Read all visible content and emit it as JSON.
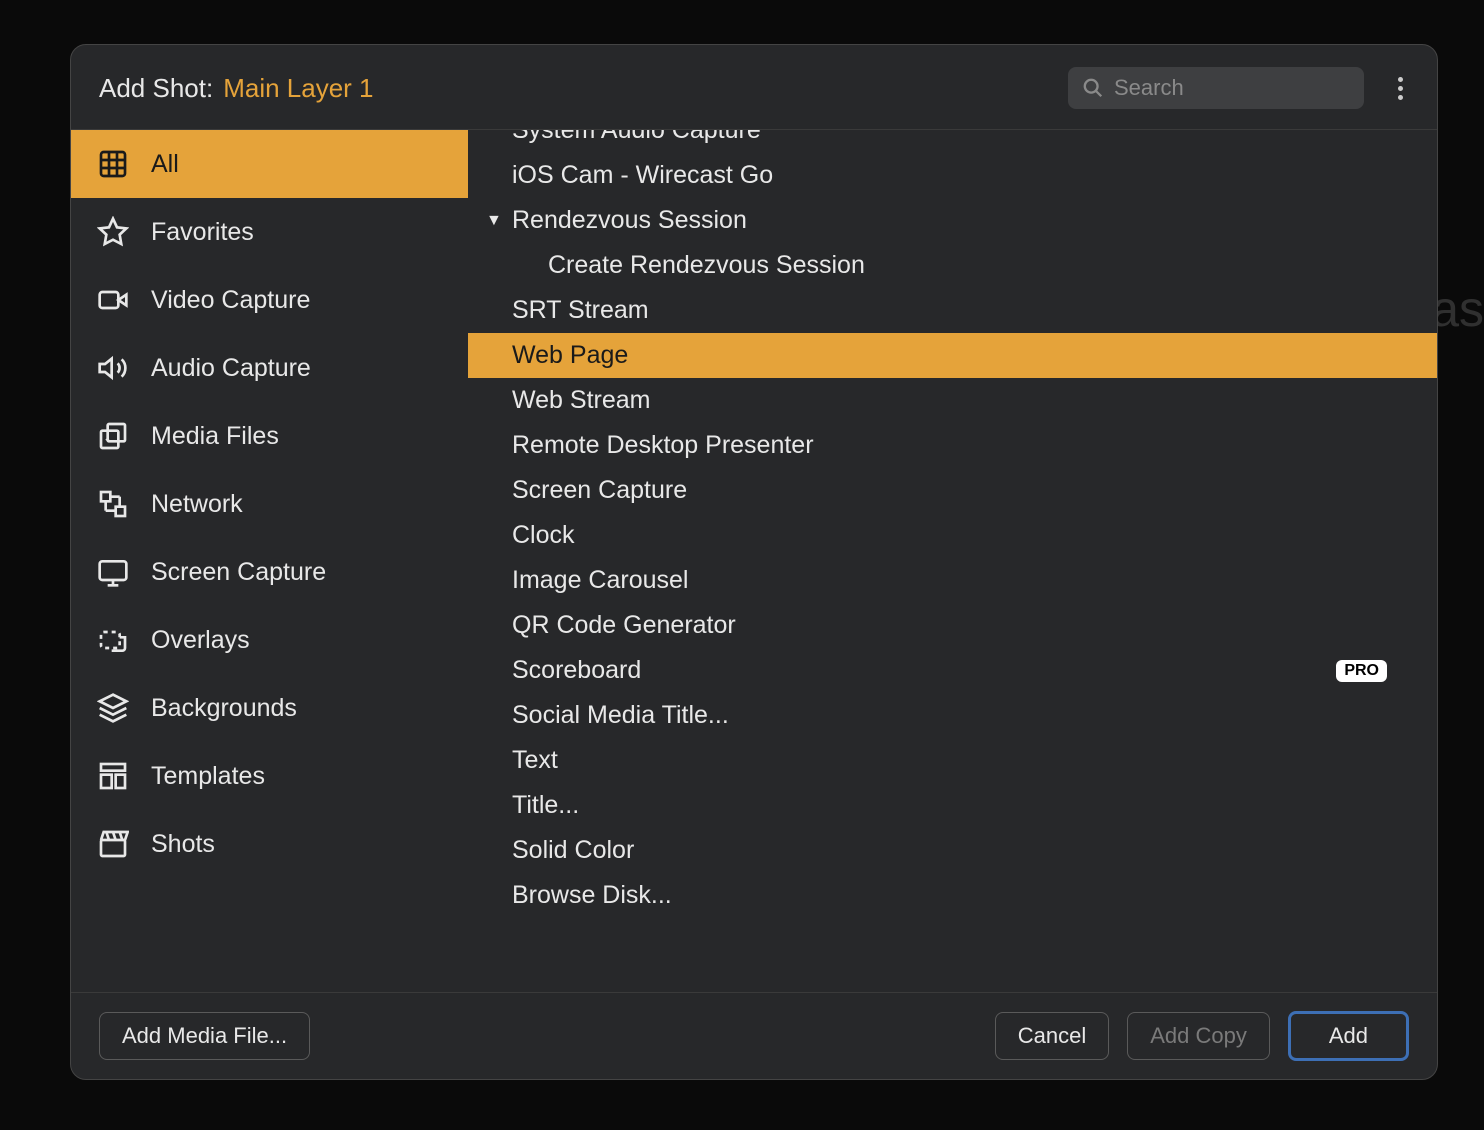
{
  "title": {
    "prefix": "Add Shot:",
    "layer": "Main Layer 1"
  },
  "search": {
    "placeholder": "Search"
  },
  "sidebar": {
    "items": [
      {
        "id": "all",
        "label": "All",
        "icon": "grid-icon",
        "selected": true
      },
      {
        "id": "favorites",
        "label": "Favorites",
        "icon": "star-icon",
        "selected": false
      },
      {
        "id": "video-capture",
        "label": "Video Capture",
        "icon": "video-icon",
        "selected": false
      },
      {
        "id": "audio-capture",
        "label": "Audio Capture",
        "icon": "speaker-icon",
        "selected": false
      },
      {
        "id": "media-files",
        "label": "Media Files",
        "icon": "media-icon",
        "selected": false
      },
      {
        "id": "network",
        "label": "Network",
        "icon": "network-icon",
        "selected": false
      },
      {
        "id": "screen-capture",
        "label": "Screen Capture",
        "icon": "monitor-icon",
        "selected": false
      },
      {
        "id": "overlays",
        "label": "Overlays",
        "icon": "overlay-icon",
        "selected": false
      },
      {
        "id": "backgrounds",
        "label": "Backgrounds",
        "icon": "layers-icon",
        "selected": false
      },
      {
        "id": "templates",
        "label": "Templates",
        "icon": "template-icon",
        "selected": false
      },
      {
        "id": "shots",
        "label": "Shots",
        "icon": "clapper-icon",
        "selected": false
      }
    ]
  },
  "content": {
    "items": [
      {
        "label": "System Audio Capture",
        "indent": 0,
        "partialTop": true
      },
      {
        "label": "iOS Cam - Wirecast Go",
        "indent": 0
      },
      {
        "label": "Rendezvous Session",
        "indent": 0,
        "disclosure": "▼"
      },
      {
        "label": "Create Rendezvous Session",
        "indent": 1
      },
      {
        "label": "SRT Stream",
        "indent": 0
      },
      {
        "label": "Web Page",
        "indent": 0,
        "selected": true
      },
      {
        "label": "Web Stream",
        "indent": 0
      },
      {
        "label": "Remote Desktop Presenter",
        "indent": 0
      },
      {
        "label": "Screen Capture",
        "indent": 0
      },
      {
        "label": "Clock",
        "indent": 0
      },
      {
        "label": "Image Carousel",
        "indent": 0
      },
      {
        "label": "QR Code Generator",
        "indent": 0
      },
      {
        "label": "Scoreboard",
        "indent": 0,
        "badge": "PRO"
      },
      {
        "label": "Social Media Title...",
        "indent": 0
      },
      {
        "label": "Text",
        "indent": 0
      },
      {
        "label": "Title...",
        "indent": 0
      },
      {
        "label": "Solid Color",
        "indent": 0
      },
      {
        "label": "Browse Disk...",
        "indent": 0
      }
    ]
  },
  "footer": {
    "addMedia": "Add Media File...",
    "cancel": "Cancel",
    "addCopy": "Add Copy",
    "add": "Add"
  }
}
